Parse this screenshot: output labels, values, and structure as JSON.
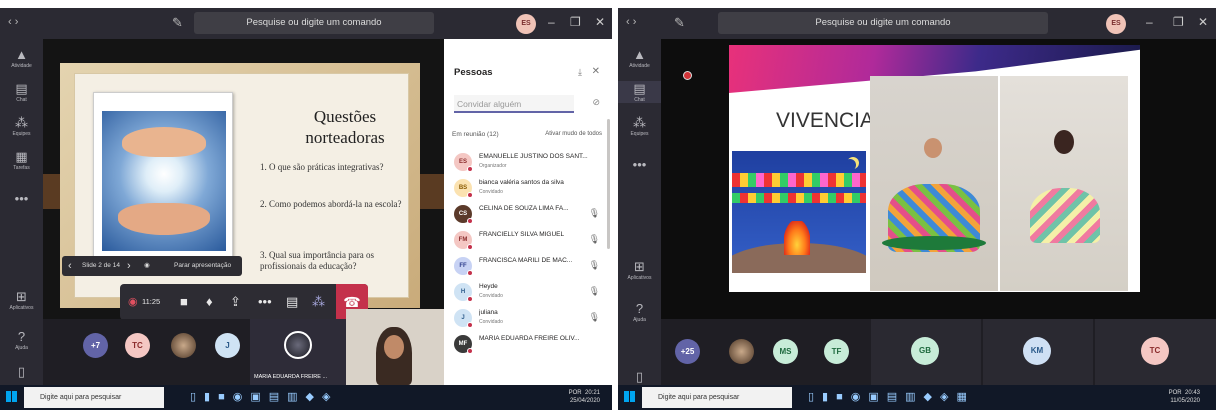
{
  "left": {
    "titlebar": {
      "nav": "‹  ›",
      "search": "Pesquise ou digite um comando",
      "avatar": "ES",
      "minimize": "–",
      "restore": "❐",
      "close": "✕"
    },
    "rail": [
      {
        "icon": "bell-icon",
        "glyph": "🔔",
        "label": "Atividade"
      },
      {
        "icon": "chat-icon",
        "glyph": "▤",
        "label": "Chat"
      },
      {
        "icon": "teams-icon",
        "glyph": "⁂",
        "label": "Equipes"
      },
      {
        "icon": "calendar-icon",
        "glyph": "▦",
        "label": "Tarefas"
      },
      {
        "icon": "more-icon",
        "glyph": "•••",
        "label": ""
      },
      {
        "icon": "apps-icon",
        "glyph": "⊞",
        "label": "Aplicativos"
      },
      {
        "icon": "help-icon",
        "glyph": "?",
        "label": "Ajuda"
      }
    ],
    "slide": {
      "title": "Questões norteadoras",
      "q1": "1. O que são práticas integrativas?",
      "q2": "2. Como podemos abordá-la na escola?",
      "q3": "3. Qual sua importância para os profissionais da educação?"
    },
    "slide_nav": {
      "prev": "‹",
      "counter": "Slide 2 de 14",
      "next": "›",
      "view": "◉",
      "stop": "Parar apresentação"
    },
    "toolbar": {
      "timer": "11:25",
      "hangup": "☎"
    },
    "panel": {
      "title": "Pessoas",
      "invite_placeholder": "Convidar alguém",
      "in_meeting": "Em reunião  (12)",
      "mute_all": "Ativar mudo de todos",
      "people": [
        {
          "initials": "ES",
          "name": "EMANUELLE JUSTINO DOS SANT...",
          "role": "Organizador",
          "bg": "#f4c7c3",
          "fg": "#8a2b2b",
          "mic": false
        },
        {
          "initials": "BS",
          "name": "bianca valéria santos da silva",
          "role": "Convidado",
          "bg": "#fbe2b0",
          "fg": "#8a5a00",
          "mic": false
        },
        {
          "initials": "CS",
          "name": "CELINA DE SOUZA LIMA FA...",
          "role": "",
          "bg": "#5b3a2a",
          "fg": "#fff",
          "mic": true
        },
        {
          "initials": "FM",
          "name": "FRANCIELLY SILVA MIGUEL",
          "role": "",
          "bg": "#f4c7c3",
          "fg": "#8a2b2b",
          "mic": true
        },
        {
          "initials": "FF",
          "name": "FRANCISCA MARILI DE MAC...",
          "role": "",
          "bg": "#c7d2f4",
          "fg": "#2b3a8a",
          "mic": true
        },
        {
          "initials": "H",
          "name": "Heyde",
          "role": "Convidado",
          "bg": "#cfe3f4",
          "fg": "#2b5a8a",
          "mic": true
        },
        {
          "initials": "J",
          "name": "juliana",
          "role": "Convidado",
          "bg": "#cfe3f4",
          "fg": "#2b5a8a",
          "mic": true
        },
        {
          "initials": "MF",
          "name": "MARIA EDUARDA FREIRE OLIV...",
          "role": "",
          "bg": "#3a3a3a",
          "fg": "#fff",
          "mic": false
        }
      ]
    },
    "gallery": {
      "more": "+7",
      "tc": "TC",
      "j": "J",
      "video_name": "MARIA EDUARDA FREIRE ..."
    },
    "taskbar": {
      "search": "Digite aqui para pesquisar",
      "time": "20:21",
      "date": "25/04/2020",
      "lang": "POR"
    }
  },
  "right": {
    "titlebar": {
      "nav": "‹  ›",
      "search": "Pesquise ou digite um comando",
      "avatar": "ES",
      "minimize": "–",
      "restore": "❐",
      "close": "✕"
    },
    "rail": [
      {
        "icon": "bell-icon",
        "glyph": "🔔",
        "label": "Atividade"
      },
      {
        "icon": "chat-icon",
        "glyph": "▤",
        "label": "Chat"
      },
      {
        "icon": "teams-icon",
        "glyph": "⁂",
        "label": "Equipes"
      },
      {
        "icon": "more-icon",
        "glyph": "•••",
        "label": ""
      },
      {
        "icon": "apps-icon",
        "glyph": "⊞",
        "label": "Aplicativos"
      },
      {
        "icon": "help-icon",
        "glyph": "?",
        "label": "Ajuda"
      }
    ],
    "slide_title": "VIVENCIA",
    "gallery": {
      "more": "+25",
      "ms": "MS",
      "tf": "TF",
      "gb": "GB",
      "km": "KM",
      "tc": "TC"
    },
    "taskbar": {
      "search": "Digite aqui para pesquisar",
      "time": "20:43",
      "date": "11/05/2020",
      "lang": "POR"
    }
  }
}
